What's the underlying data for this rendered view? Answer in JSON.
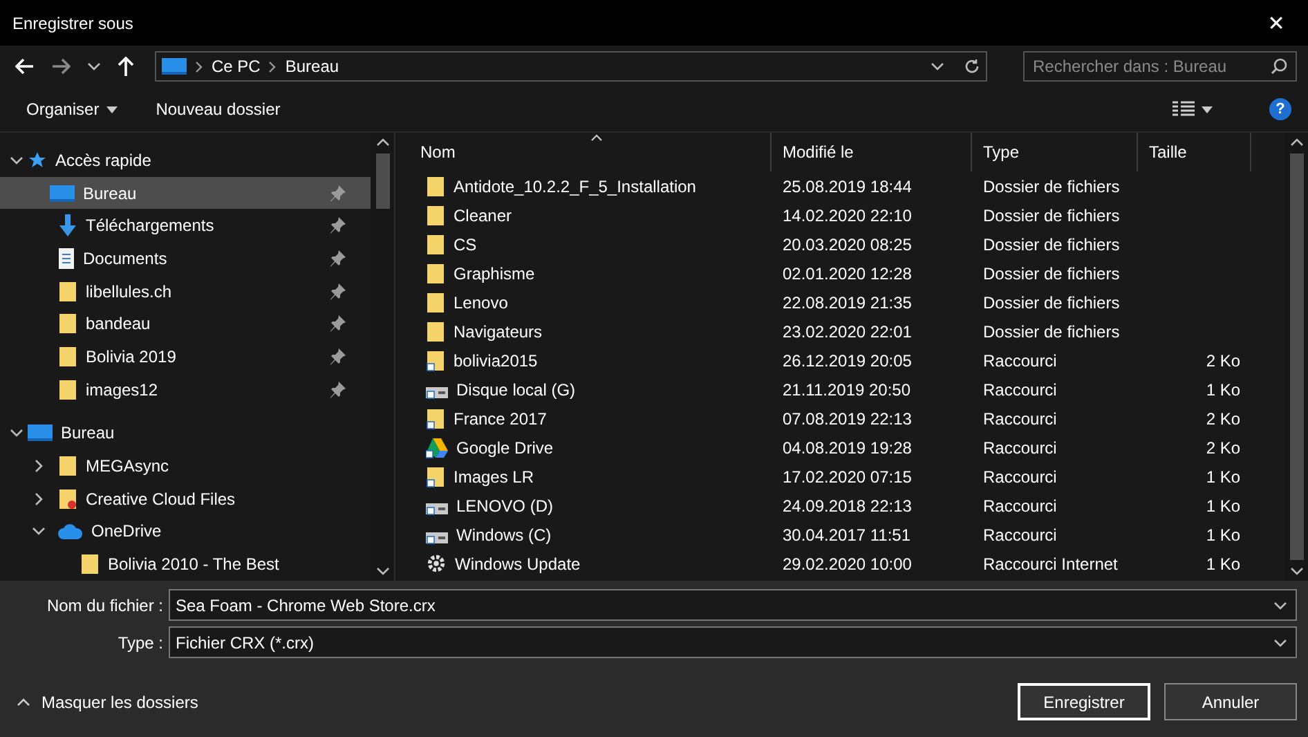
{
  "window": {
    "title": "Enregistrer sous",
    "close": "✕"
  },
  "nav": {
    "path": [
      "Ce PC",
      "Bureau"
    ],
    "search": {
      "placeholder": "Rechercher dans : Bureau"
    }
  },
  "toolbar": {
    "organize": "Organiser",
    "new_folder": "Nouveau dossier",
    "help": "?"
  },
  "sidebar": {
    "items": [
      {
        "label": "Accès rapide",
        "kind": "star",
        "expanded": true,
        "selected": false,
        "children": [
          {
            "label": "Bureau",
            "kind": "desktop",
            "pinned": true,
            "selected": true
          },
          {
            "label": "Téléchargements",
            "kind": "download",
            "pinned": true,
            "selected": false
          },
          {
            "label": "Documents",
            "kind": "document",
            "pinned": true,
            "selected": false
          },
          {
            "label": "libellules.ch",
            "kind": "folder",
            "pinned": true,
            "selected": false
          },
          {
            "label": "bandeau",
            "kind": "folder",
            "pinned": true,
            "selected": false
          },
          {
            "label": "Bolivia 2019",
            "kind": "folder",
            "pinned": true,
            "selected": false
          },
          {
            "label": "images12",
            "kind": "folder",
            "pinned": true,
            "selected": false
          }
        ]
      },
      {
        "label": "Bureau",
        "kind": "desktop",
        "expanded": true,
        "selected": false,
        "children": [
          {
            "label": "MEGAsync",
            "kind": "folder",
            "expanded": false,
            "selected": false
          },
          {
            "label": "Creative Cloud Files",
            "kind": "cc-folder",
            "expanded": false,
            "selected": false
          },
          {
            "label": "OneDrive",
            "kind": "cloud",
            "expanded": true,
            "selected": false,
            "children": [
              {
                "label": "Bolivia 2010 - The Best",
                "kind": "folder",
                "selected": false
              }
            ]
          }
        ]
      }
    ]
  },
  "table": {
    "columns": [
      {
        "label": "Nom",
        "sorted": true
      },
      {
        "label": "Modifié le",
        "sorted": false
      },
      {
        "label": "Type",
        "sorted": false
      },
      {
        "label": "Taille",
        "sorted": false
      }
    ],
    "rows": [
      {
        "name": "Antidote_10.2.2_F_5_Installation",
        "kind": "folder",
        "modified": "25.08.2019 18:44",
        "type": "Dossier de fichiers"
      },
      {
        "name": "Cleaner",
        "kind": "folder",
        "modified": "14.02.2020 22:10",
        "type": "Dossier de fichiers"
      },
      {
        "name": "CS",
        "kind": "folder",
        "modified": "20.03.2020 08:25",
        "type": "Dossier de fichiers"
      },
      {
        "name": "Graphisme",
        "kind": "folder",
        "modified": "02.01.2020 12:28",
        "type": "Dossier de fichiers"
      },
      {
        "name": "Lenovo",
        "kind": "folder",
        "modified": "22.08.2019 21:35",
        "type": "Dossier de fichiers"
      },
      {
        "name": "Navigateurs",
        "kind": "folder",
        "modified": "23.02.2020 22:01",
        "type": "Dossier de fichiers"
      },
      {
        "name": "bolivia2015",
        "kind": "folder-shortcut",
        "modified": "26.12.2019 20:05",
        "type": "Raccourci",
        "size": "2 Ko"
      },
      {
        "name": "Disque local (G)",
        "kind": "drive-shortcut",
        "modified": "21.11.2019 20:50",
        "type": "Raccourci",
        "size": "1 Ko"
      },
      {
        "name": "France 2017",
        "kind": "folder-shortcut",
        "modified": "07.08.2019 22:13",
        "type": "Raccourci",
        "size": "2 Ko"
      },
      {
        "name": "Google Drive",
        "kind": "drive-app-shortcut",
        "modified": "04.08.2019 19:28",
        "type": "Raccourci",
        "size": "2 Ko"
      },
      {
        "name": "Images LR",
        "kind": "folder-shortcut",
        "modified": "17.02.2020 07:15",
        "type": "Raccourci",
        "size": "1 Ko"
      },
      {
        "name": "LENOVO (D)",
        "kind": "drive-shortcut",
        "modified": "24.09.2018 22:13",
        "type": "Raccourci",
        "size": "1 Ko"
      },
      {
        "name": "Windows (C)",
        "kind": "drive-shortcut",
        "modified": "30.04.2017 11:51",
        "type": "Raccourci",
        "size": "1 Ko"
      },
      {
        "name": "Windows Update",
        "kind": "gear",
        "modified": "29.02.2020 10:00",
        "type": "Raccourci Internet",
        "size": "1 Ko"
      }
    ]
  },
  "form": {
    "filename": {
      "label": "Nom du fichier :",
      "value": "Sea Foam - Chrome Web Store.crx"
    },
    "type": {
      "label": "Type :",
      "value": "Fichier CRX (*.crx)"
    }
  },
  "footer": {
    "hide_folders": "Masquer les dossiers",
    "save": "Enregistrer",
    "cancel": "Annuler"
  }
}
